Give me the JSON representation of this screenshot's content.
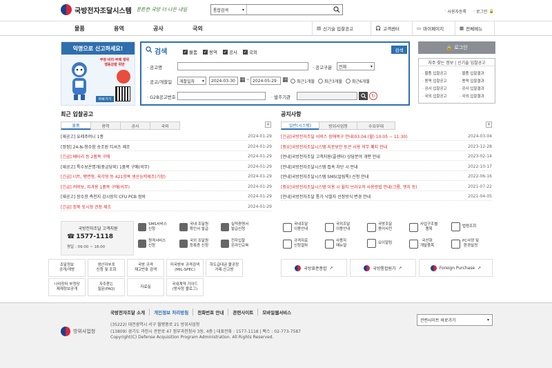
{
  "header": {
    "title": "국방전자조달시스템",
    "slogan": "튼튼한 국방 더 나은 내일",
    "search_scope": "통합검색",
    "search_placeholder": "",
    "util": [
      "사용자등록",
      "로그인"
    ]
  },
  "nav": {
    "menus": [
      "물품",
      "용역",
      "공사",
      "국외"
    ],
    "right": [
      "신기술 입찰공고",
      "고객센터",
      "마이페이지",
      "전체메뉴"
    ]
  },
  "banner": {
    "title": "익명으로 신고하세요!",
    "text1": "부정·비리·부패 행위",
    "text2": "행동강령 위반",
    "button": "바로가기"
  },
  "search": {
    "title": "검색",
    "checks": [
      "물품",
      "용역",
      "공사",
      "국외"
    ],
    "button": "검색",
    "name_label": "공고명",
    "type_label": "공고구분",
    "type_value": "전체",
    "date_label": "공고/개찰일",
    "date_type": "개찰일자",
    "date_from": "2024-03-30",
    "date_to": "2024-05-29",
    "period_options": [
      "최근1개월",
      "최근3개월",
      "최근6개월"
    ],
    "g2b_label": "G2B공고번호",
    "org_label": "발주기관"
  },
  "login": {
    "button": "로그인",
    "quick_title": "자주 찾는 정보 | 신기술 입찰공고",
    "quick_left": [
      "물품 입찰공고",
      "용역 입찰공고",
      "공사 입찰공고",
      "국외 입찰공고"
    ],
    "quick_right": [
      "물품 입찰결과",
      "용역 입찰결과",
      "공사 입찰결과",
      "국외 입찰결과"
    ]
  },
  "bids": {
    "title": "최근 입찰공고",
    "tabs": [
      "물품",
      "용역",
      "공사",
      "국외"
    ],
    "rows": [
      {
        "title": "[재공고] 유레주머니 1종",
        "date": "2024-01-29",
        "urgent": false
      },
      {
        "title": "[정정] 24-N-청수함 송조원 티셔츠 제조",
        "date": "2024-01-29",
        "urgent": false
      },
      {
        "title": "[긴급] 베터리 등 2품목 구매",
        "date": "2024-01-29",
        "urgent": true
      },
      {
        "title": "[재공고] 특수보온명개(중금당외) 1품목 구매(의무)",
        "date": "2024-01-29",
        "urgent": false
      },
      {
        "title": "[긴급] 너트, 평면형, 육각형 등 421항목 생산능력제조(기장)",
        "date": "2024-01-29",
        "urgent": true
      },
      {
        "title": "[긴급] 커버보, 지과용 1품목 구매(의무)",
        "date": "2024-01-29",
        "urgent": true
      },
      {
        "title": "[재공고] 장수항 측천지 감시장치 CFU PCB 정비",
        "date": "2024-01-29",
        "urgent": false
      },
      {
        "title": "[긴급] 정북 토시형 견장 제조",
        "date": "2024-01-29",
        "urgent": true
      }
    ]
  },
  "notices": {
    "title": "공지사항",
    "tabs": [
      "일반(시스템)",
      "방위사업청",
      "수요부대"
    ],
    "rows": [
      {
        "title": "[긴급]국방전자조달 서비스 장애복구 안내(03.04.(월) 10:05 ~ 11:30)",
        "date": "2024-03-04",
        "urgent": true
      },
      {
        "title": "[중요]국방전자조달시스템 지문보안 토큰 사용 의무 폐지 안내",
        "date": "2023-12-28",
        "urgent": true
      },
      {
        "title": "[안내]국방전자조달 고객지원(콜센터) 상담분야 개편 안내",
        "date": "2023-02-14",
        "urgent": false
      },
      {
        "title": "[안내]국방전자조달시스템 접속 차단 시 안내",
        "date": "2022-10-17",
        "urgent": false
      },
      {
        "title": "[안내]국방전자조달시스템 SMS(알림톡) 신청 안내",
        "date": "2022-06-16",
        "urgent": false
      },
      {
        "title": "[중요]국방전자조달시스템 이용 시 윌티 브라우저 사용방법 안내(크롬, 엣지 등)",
        "date": "2021-07-22",
        "urgent": true
      },
      {
        "title": "[안내]국방전자조달 통가 낙찰자 선정방식 변경 안내",
        "date": "2021-04-05",
        "urgent": false
      }
    ]
  },
  "callcenter": {
    "title": "국방전자조달 고객지원",
    "phone": "1577-1118",
    "hours": "평일 : 09:00 ~ 18:00"
  },
  "services_left": [
    {
      "l1": "SMS서비스",
      "l2": "신청"
    },
    {
      "l1": "국내 조달원",
      "l2": "확인서 발급"
    },
    {
      "l1": "실적증명서",
      "l2": "발급신청"
    },
    {
      "l1": "원격서비스",
      "l2": "신청"
    },
    {
      "l1": "국외 조달원",
      "l2": "등록증 신청"
    },
    {
      "l1": "전자입찰",
      "l2": "온라인교육"
    }
  ],
  "services_right": [
    {
      "l1": "국내조달",
      "l2": "이용안내"
    },
    {
      "l1": "국외조달",
      "l2": "이용안내"
    },
    {
      "l1": "국방조달",
      "l2": "용어사전"
    },
    {
      "l1": "사업구조별",
      "l2": "품목"
    },
    {
      "l1": "법령조회",
      "l2": ""
    },
    {
      "l1": "규격자료",
      "l2": "신청절차"
    },
    {
      "l1": "사용자",
      "l2": "매뉴얼"
    },
    {
      "l1": "요이알림",
      "l2": ""
    },
    {
      "l1": "국산화",
      "l2": "개발품목"
    },
    {
      "l1": "PC사양 및",
      "l2": "환경설정"
    }
  ],
  "links_grid": [
    {
      "l1": "조달정보",
      "l2": "공개/개방"
    },
    {
      "l1": "생산자부포",
      "l2": "신청 및 조회"
    },
    {
      "l1": "국방 규격",
      "l2": "제고번호 검색"
    },
    {
      "l1": "미국방부 규격검색",
      "l2": "(MIL-SPEC)"
    },
    {
      "l1": "하도급대금 불공정",
      "l2": "거래 신고방"
    },
    {
      "l1": "나라장터 부정당",
      "l2": "제재정보공개"
    },
    {
      "l1": "자주묻는",
      "l2": "질문(FAQ)"
    },
    {
      "l1": "자료실",
      "l2": ""
    },
    {
      "l1": "국내계약 가이드",
      "l2": "(방사청 블로그)"
    }
  ],
  "banners_right": [
    "국방표준종합",
    "국방통합원가",
    "Foreign Purchase"
  ],
  "footer": {
    "org": "방위사업청",
    "links": [
      "국방전자조달 소개",
      "개인정보 처리방침",
      "전화번호 안내",
      "관련사이트",
      "모바일웹서비스"
    ],
    "addr1": "(35222) 대전광역시 서구 월평중로 21 방위사업청",
    "addr2": "(13809) 경기도 과천시 관문로 47 정부과천청사 3동, 4층  |  대표전화 : 1577-1118  |  팩스 : 02-773-7587",
    "copyright": "Copyright(C) Defense Acquisition Program Administration. All Rights Reserved.",
    "related": "관련사이트 바로가기"
  }
}
